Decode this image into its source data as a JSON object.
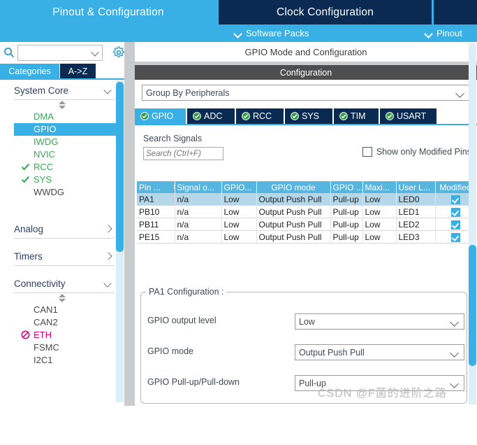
{
  "top_tabs": [
    {
      "label": "Pinout & Configuration",
      "active": false
    },
    {
      "label": "Clock Configuration",
      "active": true
    },
    {
      "label": "",
      "active": true
    }
  ],
  "subbar": {
    "software_packs": "Software Packs",
    "pinout": "Pinout"
  },
  "sidebar": {
    "search_value": "",
    "search_placeholder": "",
    "tabs": [
      {
        "label": "Categories",
        "active": true
      },
      {
        "label": "A->Z",
        "active": false
      }
    ],
    "groups": [
      {
        "label": "System Core",
        "expanded": true,
        "items": [
          {
            "label": "DMA",
            "state": "green",
            "checked": false,
            "selected": false
          },
          {
            "label": "GPIO",
            "state": "selected",
            "checked": false,
            "selected": true
          },
          {
            "label": "IWDG",
            "state": "green",
            "checked": false,
            "selected": false
          },
          {
            "label": "NVIC",
            "state": "green",
            "checked": false,
            "selected": false
          },
          {
            "label": "RCC",
            "state": "green",
            "checked": true,
            "selected": false
          },
          {
            "label": "SYS",
            "state": "green",
            "checked": true,
            "selected": false
          },
          {
            "label": "WWDG",
            "state": "plain",
            "checked": false,
            "selected": false
          }
        ]
      },
      {
        "label": "Analog",
        "expanded": false,
        "items": []
      },
      {
        "label": "Timers",
        "expanded": false,
        "items": []
      },
      {
        "label": "Connectivity",
        "expanded": true,
        "items": [
          {
            "label": "CAN1",
            "state": "plain",
            "checked": false,
            "selected": false
          },
          {
            "label": "CAN2",
            "state": "plain",
            "checked": false,
            "selected": false
          },
          {
            "label": "ETH",
            "state": "magenta",
            "checked": false,
            "selected": false,
            "banned": true
          },
          {
            "label": "FSMC",
            "state": "plain",
            "checked": false,
            "selected": false
          },
          {
            "label": "I2C1",
            "state": "plain",
            "checked": false,
            "selected": false
          }
        ]
      }
    ]
  },
  "main": {
    "title": "GPIO Mode and Configuration",
    "configuration_band": "Configuration",
    "group_by": "Group By Peripherals",
    "peripheral_tabs": [
      {
        "label": "GPIO",
        "active": true
      },
      {
        "label": "ADC",
        "active": false
      },
      {
        "label": "RCC",
        "active": false
      },
      {
        "label": "SYS",
        "active": false
      },
      {
        "label": "TIM",
        "active": false
      },
      {
        "label": "USART",
        "active": false
      }
    ],
    "search_signals_label": "Search Signals",
    "search_signals_value": "",
    "search_signals_placeholder": "Search (Ctrl+F)",
    "show_only_modified": "Show only Modified Pins",
    "show_only_modified_checked": false,
    "table": {
      "columns": [
        "Pin ...",
        "Signal o...",
        "GPIO...",
        "GPIO mode",
        "GPIO ...",
        "Maxi...",
        "User L...",
        "Modified"
      ],
      "rows": [
        {
          "pin": "PA1",
          "signal": "n/a",
          "output": "Low",
          "mode": "Output Push Pull",
          "pull": "Pull-up",
          "max": "Low",
          "user_label": "LED0",
          "modified": true,
          "selected": true
        },
        {
          "pin": "PB10",
          "signal": "n/a",
          "output": "Low",
          "mode": "Output Push Pull",
          "pull": "Pull-up",
          "max": "Low",
          "user_label": "LED1",
          "modified": true,
          "selected": false
        },
        {
          "pin": "PB11",
          "signal": "n/a",
          "output": "Low",
          "mode": "Output Push Pull",
          "pull": "Pull-up",
          "max": "Low",
          "user_label": "LED2",
          "modified": true,
          "selected": false
        },
        {
          "pin": "PE15",
          "signal": "n/a",
          "output": "Low",
          "mode": "Output Push Pull",
          "pull": "Pull-up",
          "max": "Low",
          "user_label": "LED3",
          "modified": true,
          "selected": false
        }
      ]
    },
    "pin_config": {
      "legend": "PA1 Configuration :",
      "fields": [
        {
          "label": "GPIO output level",
          "value": "Low"
        },
        {
          "label": "GPIO mode",
          "value": "Output Push Pull"
        },
        {
          "label": "GPIO Pull-up/Pull-down",
          "value": "Pull-up"
        }
      ]
    }
  },
  "watermark": "CSDN @F菌的进阶之路",
  "colors": {
    "accent_blue": "#39b0e5",
    "dark_navy": "#0b2a52",
    "table_header": "#57b6e0",
    "row_selected": "#b4d7ea",
    "green": "#3aa655",
    "magenta": "#e6007e",
    "band_gray": "#4e4e4e"
  }
}
